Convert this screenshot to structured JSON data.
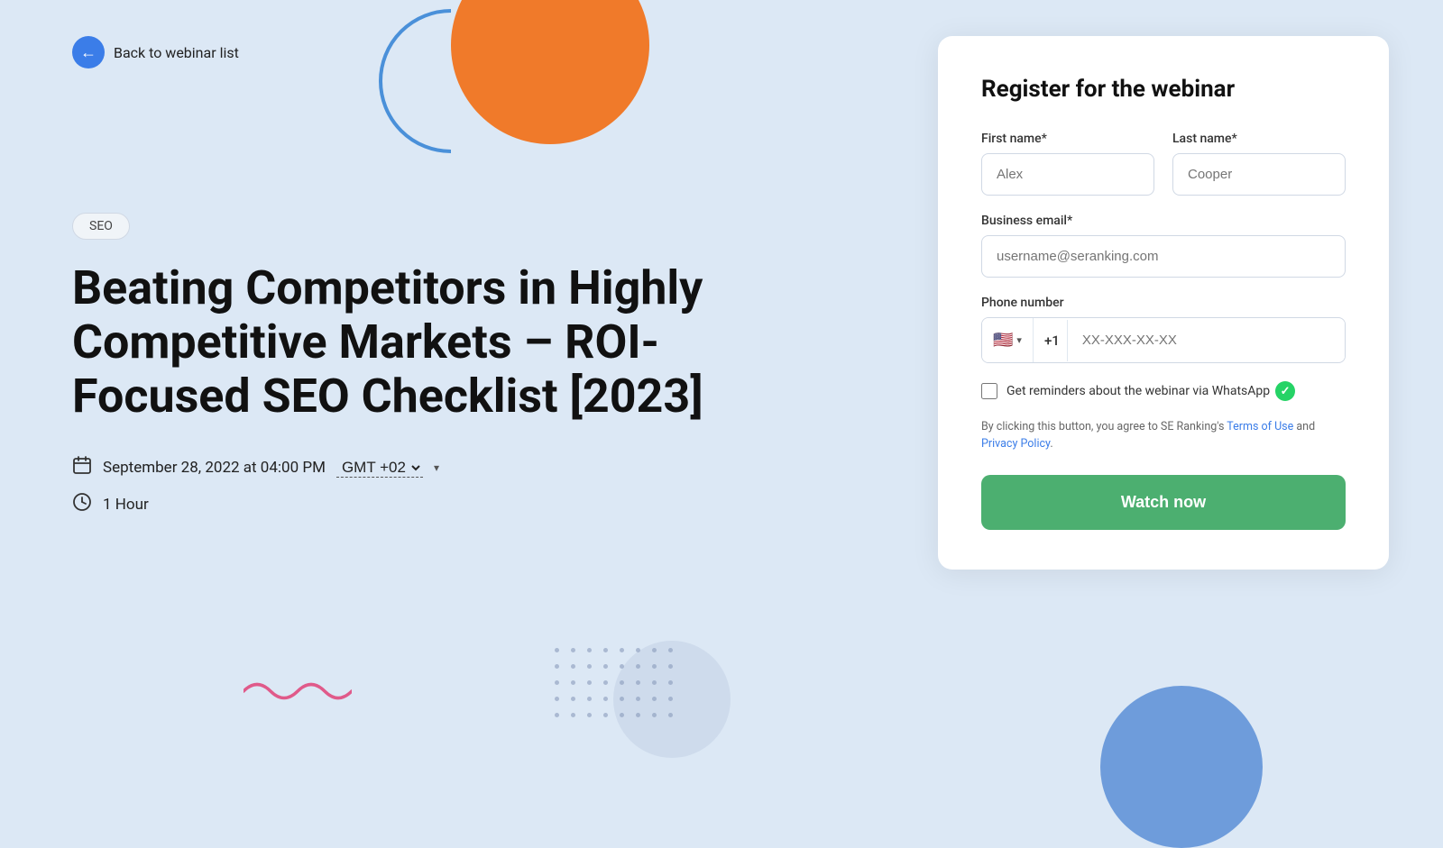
{
  "page": {
    "bg_color": "#dce8f5"
  },
  "back_button": {
    "label": "Back to webinar list"
  },
  "category": {
    "badge": "SEO"
  },
  "webinar": {
    "title": "Beating Competitors in Highly Competitive Markets – ROI-Focused SEO Checklist [2023]",
    "date_label": "September 28, 2022 at 04:00 PM",
    "timezone_label": "GMT +02",
    "duration_label": "1 Hour"
  },
  "form": {
    "title": "Register for the webinar",
    "first_name_label": "First name*",
    "first_name_placeholder": "Alex",
    "last_name_label": "Last name*",
    "last_name_placeholder": "Cooper",
    "email_label": "Business email*",
    "email_placeholder": "username@seranking.com",
    "phone_label": "Phone number",
    "phone_code": "+1",
    "phone_placeholder": "XX-XXX-XX-XX",
    "whatsapp_checkbox_label": "Get reminders about the webinar via WhatsApp",
    "terms_text_before": "By clicking this button, you agree to SE Ranking's ",
    "terms_of_use_label": "Terms of Use",
    "terms_and": " and ",
    "privacy_policy_label": "Privacy Policy",
    "terms_text_after": ".",
    "submit_label": "Watch now"
  }
}
